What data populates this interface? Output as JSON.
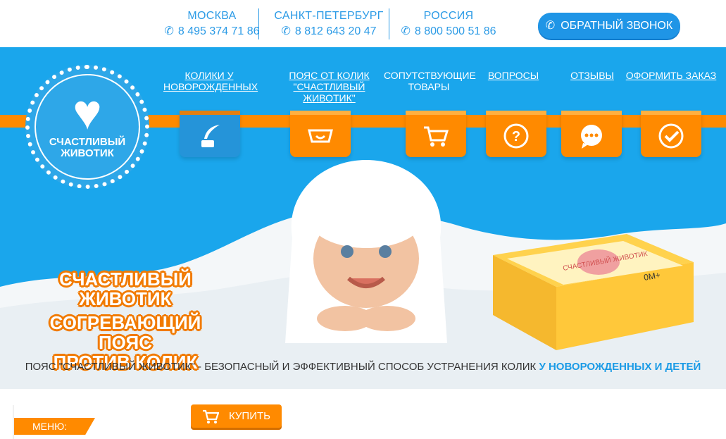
{
  "contacts": [
    {
      "city": "МОСКВА",
      "phone": "8 495 374 71 86"
    },
    {
      "city": "САНКТ-ПЕТЕРБУРГ",
      "phone": "8 812 643 20 47"
    },
    {
      "city": "РОССИЯ",
      "phone": "8 800 500 51 86"
    }
  ],
  "callback_label": "ОБРАТНЫЙ ЗВОНОК",
  "logo_text": "СЧАСТЛИВЫЙ ЖИВОТИК",
  "nav": [
    {
      "label": "КОЛИКИ У НОВОРОЖДЕННЫХ",
      "icon": "feather-ink-icon",
      "underlined": true,
      "active": true
    },
    {
      "label": "ПОЯС ОТ КОЛИК \"СЧАСТЛИВЫЙ ЖИВОТИК\"",
      "icon": "belt-icon",
      "underlined": true,
      "active": false
    },
    {
      "label": "СОПУТСТВУЮЩИЕ ТОВАРЫ",
      "icon": "cart-icon",
      "underlined": false,
      "active": false
    },
    {
      "label": "ВОПРОСЫ",
      "icon": "question-icon",
      "underlined": true,
      "active": false
    },
    {
      "label": "ОТЗЫВЫ",
      "icon": "chat-icon",
      "underlined": true,
      "active": false
    },
    {
      "label": "ОФОРМИТЬ ЗАКАЗ",
      "icon": "check-icon",
      "underlined": true,
      "active": false
    }
  ],
  "slogan": {
    "line1": "СЧАСТЛИВЫЙ",
    "line2": "ЖИВОТИК",
    "line3": "СОГРЕВАЮЩИЙ ПОЯС",
    "line4": "ПРОТИВ КОЛИК"
  },
  "tagline": {
    "main": "ПОЯС \"СЧАСТЛИВЫЙ ЖИВОТИК\" - БЕЗОПАСНЫЙ И ЭФФЕКТИВНЫЙ СПОСОБ УСТРАНЕНИЯ КОЛИК ",
    "highlight": "У НОВОРОЖДЕННЫХ И ДЕТЕЙ"
  },
  "product_box": {
    "brand": "СЧАСТЛИВЫЙ ЖИВОТИК",
    "age": "0М+"
  },
  "menu_label": "МЕНЮ:",
  "buy_label": "КУПИТЬ",
  "colors": {
    "primary_blue": "#1aa6ec",
    "accent_orange": "#ff8a00",
    "text_blue": "#2c9be6"
  }
}
